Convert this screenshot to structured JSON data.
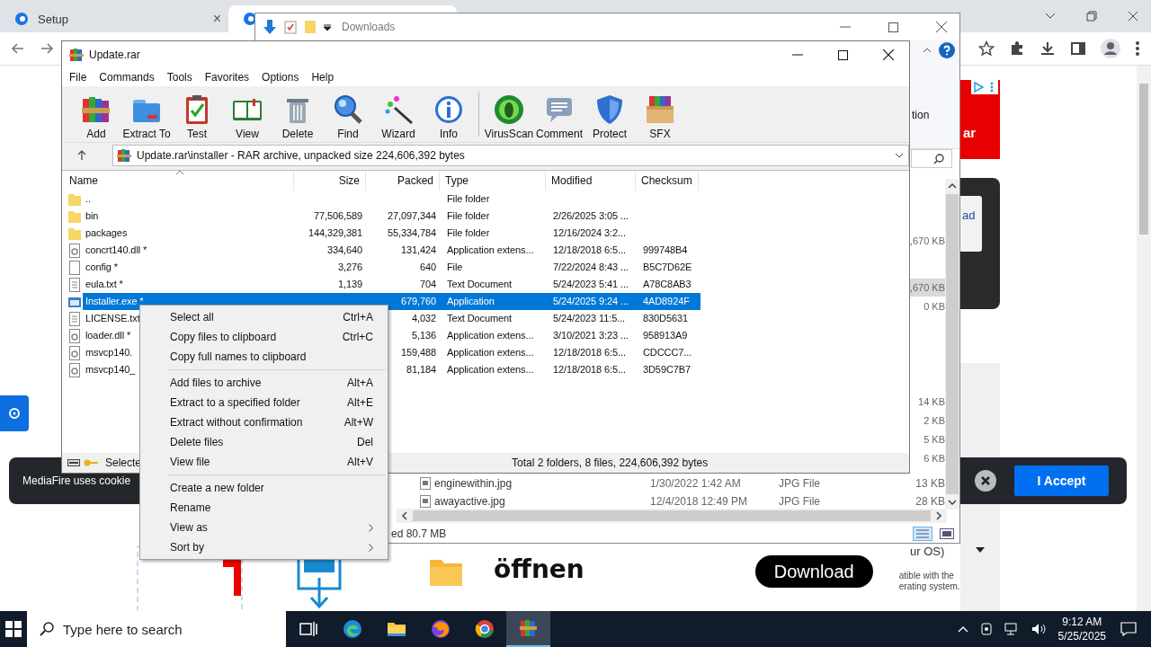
{
  "browser": {
    "tabs": [
      {
        "title": "Setup",
        "close": "×",
        "selected": false
      },
      {
        "selected": true
      }
    ]
  },
  "page": {
    "ad": {
      "text": "ar"
    },
    "panel": {
      "link": "ad"
    },
    "cookie_banner": {
      "text": "MediaFire uses cookie",
      "accept": "I Accept"
    },
    "promo": {
      "verb": "öffnen",
      "download": "Download",
      "os_select": "ur OS)",
      "compat": [
        "atible with the",
        "erating system."
      ]
    }
  },
  "explorer": {
    "title": "Downloads",
    "ribbon_text": "tion",
    "rows": [
      {
        "size": ",670 KB",
        "selected": false
      },
      {
        "size": ",670 KB",
        "selected": true
      },
      {
        "size": "0 KB",
        "selected": false
      },
      {
        "size": "14 KB",
        "selected": false
      },
      {
        "size": "2 KB",
        "selected": false
      },
      {
        "size": "5 KB",
        "selected": false
      },
      {
        "size": "6 KB",
        "selected": false
      },
      {
        "name": "enginewithin.jpg",
        "modified": "1/30/2022 1:42 AM",
        "type": "JPG File",
        "size": "13 KB",
        "selected": false
      },
      {
        "name": "awayactive.jpg",
        "modified": "12/4/2018 12:49 PM",
        "type": "JPG File",
        "size": "28 KB",
        "selected": false
      }
    ],
    "status": "ed 80.7 MB"
  },
  "winrar": {
    "title": "Update.rar",
    "menu": [
      "File",
      "Commands",
      "Tools",
      "Favorites",
      "Options",
      "Help"
    ],
    "toolbar": [
      {
        "kind": "button",
        "label": "Add"
      },
      {
        "kind": "button",
        "label": "Extract To"
      },
      {
        "kind": "button",
        "label": "Test"
      },
      {
        "kind": "button",
        "label": "View"
      },
      {
        "kind": "button",
        "label": "Delete"
      },
      {
        "kind": "button",
        "label": "Find"
      },
      {
        "kind": "button",
        "label": "Wizard"
      },
      {
        "kind": "button",
        "label": "Info"
      },
      {
        "kind": "separator"
      },
      {
        "kind": "button",
        "label": "VirusScan"
      },
      {
        "kind": "button",
        "label": "Comment"
      },
      {
        "kind": "button",
        "label": "Protect"
      },
      {
        "kind": "button",
        "label": "SFX"
      }
    ],
    "path": "Update.rar\\installer - RAR archive, unpacked size 224,606,392 bytes",
    "columns": [
      "Name",
      "Size",
      "Packed",
      "Type",
      "Modified",
      "Checksum"
    ],
    "rows": [
      {
        "kind": "folder",
        "name": "..",
        "type": "File folder",
        "selected": false
      },
      {
        "kind": "folder",
        "name": "bin",
        "size": "77,506,589",
        "packed": "27,097,344",
        "type": "File folder",
        "modified": "2/26/2025 3:05 ...",
        "selected": false
      },
      {
        "kind": "folder",
        "name": "packages",
        "size": "144,329,381",
        "packed": "55,334,784",
        "type": "File folder",
        "modified": "12/16/2024 3:2...",
        "selected": false
      },
      {
        "kind": "dll",
        "name": "concrt140.dll *",
        "size": "334,640",
        "packed": "131,424",
        "type": "Application extens...",
        "modified": "12/18/2018 6:5...",
        "checksum": "999748B4",
        "selected": false
      },
      {
        "kind": "file",
        "name": "config *",
        "size": "3,276",
        "packed": "640",
        "type": "File",
        "modified": "7/22/2024 8:43 ...",
        "checksum": "B5C7D62E",
        "selected": false
      },
      {
        "kind": "text",
        "name": "eula.txt *",
        "size": "1,139",
        "packed": "704",
        "type": "Text Document",
        "modified": "5/24/2023 5:41 ...",
        "checksum": "A78C8AB3",
        "selected": false
      },
      {
        "kind": "exe",
        "name": "Installer.exe *",
        "packed": "679,760",
        "type": "Application",
        "modified": "5/24/2025 9:24 ...",
        "checksum": "4AD8924F",
        "selected": true
      },
      {
        "kind": "text",
        "name": "LICENSE.txt",
        "packed": "4,032",
        "type": "Text Document",
        "modified": "5/24/2023 11:5...",
        "checksum": "830D5631",
        "selected": false
      },
      {
        "kind": "dll",
        "name": "loader.dll *",
        "packed": "5,136",
        "type": "Application extens...",
        "modified": "3/10/2021 3:23 ...",
        "checksum": "958913A9",
        "selected": false
      },
      {
        "kind": "dll",
        "name": "msvcp140.",
        "packed": "159,488",
        "type": "Application extens...",
        "modified": "12/18/2018 6:5...",
        "checksum": "CDCCC7...",
        "selected": false
      },
      {
        "kind": "dll",
        "name": "msvcp140_",
        "packed": "81,184",
        "type": "Application extens...",
        "modified": "12/18/2018 6:5...",
        "checksum": "3D59C7B7",
        "selected": false
      }
    ],
    "status": {
      "selection": "Selecte",
      "total": "Total 2 folders, 8 files, 224,606,392 bytes"
    }
  },
  "context_menu": [
    {
      "kind": "item",
      "label": "Select all",
      "shortcut": "Ctrl+A"
    },
    {
      "kind": "item",
      "label": "Copy files to clipboard",
      "shortcut": "Ctrl+C"
    },
    {
      "kind": "item",
      "label": "Copy full names to clipboard"
    },
    {
      "kind": "separator"
    },
    {
      "kind": "item",
      "label": "Add files to archive",
      "shortcut": "Alt+A"
    },
    {
      "kind": "item",
      "label": "Extract to a specified folder",
      "shortcut": "Alt+E"
    },
    {
      "kind": "item",
      "label": "Extract without confirmation",
      "shortcut": "Alt+W"
    },
    {
      "kind": "item",
      "label": "Delete files",
      "shortcut": "Del"
    },
    {
      "kind": "item",
      "label": "View file",
      "shortcut": "Alt+V"
    },
    {
      "kind": "separator"
    },
    {
      "kind": "item",
      "label": "Create a new folder"
    },
    {
      "kind": "item",
      "label": "Rename"
    },
    {
      "kind": "submenu",
      "label": "View as"
    },
    {
      "kind": "submenu",
      "label": "Sort by"
    }
  ],
  "taskbar": {
    "search": {
      "placeholder": "Type here to search"
    },
    "apps": [
      {
        "selected": false
      },
      {
        "selected": false
      },
      {
        "selected": false
      },
      {
        "selected": false
      },
      {
        "selected": false
      },
      {
        "selected": true
      }
    ],
    "time": "9:12 AM",
    "date": "5/25/2025"
  }
}
